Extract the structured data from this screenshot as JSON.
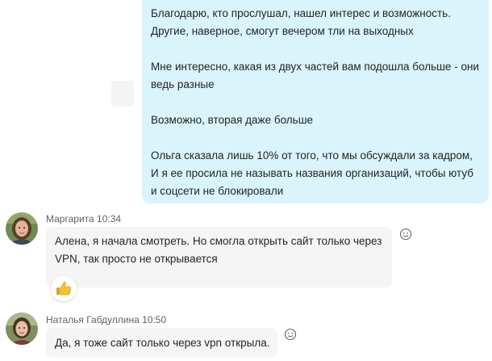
{
  "own_message": {
    "paragraphs": [
      [
        "Благодарю, кто прослушал, нашел интерес и возможность.",
        "Другие, наверное, смогут вечером тли на выходных"
      ],
      [
        "Мне интересно, какая из двух частей вам подошла больше - они",
        "ведь разные"
      ],
      [
        "Возможно, вторая даже больше"
      ],
      [
        "Ольга сказала лишь 10% от того, что мы обсуждали за кадром,",
        "И я ее просила не называть названия организаций, чтобы ютуб",
        "и соцсети не блокировали"
      ]
    ]
  },
  "messages": [
    {
      "author": "Маргарита",
      "time": "10:34",
      "lines": [
        "Алена, я начала смотреть. Но смогла открыть сайт только через",
        "VPN, так просто не открывается"
      ],
      "reaction": "thumbs-up"
    },
    {
      "author": "Наталья Габдуллина",
      "time": "10:50",
      "lines": [
        "Да, я тоже сайт только через vpn открыла."
      ]
    }
  ],
  "colors": {
    "own_bubble": "#d9f4fa",
    "other_bubble": "#f5f5f5",
    "meta_text": "#616161"
  },
  "icons": [
    "smile-icon",
    "thumbs-up-icon"
  ]
}
